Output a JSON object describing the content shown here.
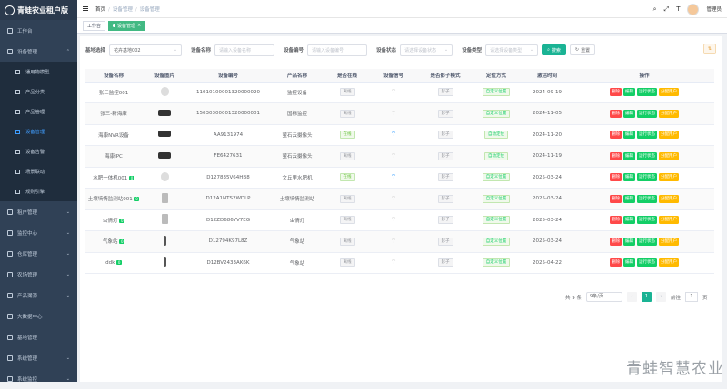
{
  "app": {
    "title": "青蛙农业租户版"
  },
  "sidebar": {
    "items": [
      {
        "label": "工作台"
      },
      {
        "label": "设备管理",
        "expanded": true
      },
      {
        "label": "租户管理"
      },
      {
        "label": "监控中心"
      },
      {
        "label": "仓库管理"
      },
      {
        "label": "农场管理"
      },
      {
        "label": "产品溯源"
      },
      {
        "label": "大数据中心"
      },
      {
        "label": "基地管理"
      },
      {
        "label": "系统管理"
      },
      {
        "label": "系统监控"
      }
    ],
    "sub_items": [
      {
        "label": "通用物模型"
      },
      {
        "label": "产品分类"
      },
      {
        "label": "产品管理"
      },
      {
        "label": "设备管理",
        "active": true
      },
      {
        "label": "设备告警"
      },
      {
        "label": "场景联动"
      },
      {
        "label": "规则引擎"
      }
    ]
  },
  "breadcrumb": [
    "首页",
    "设备管理",
    "设备管理"
  ],
  "user": {
    "name": "管理员"
  },
  "tags": [
    {
      "label": "工作台"
    },
    {
      "label": "设备管理"
    }
  ],
  "filters": {
    "base_label": "基地选择",
    "base_value": "花卉基地002",
    "name_label": "设备名称",
    "name_placeholder": "请输入设备名称",
    "code_label": "设备编号",
    "code_placeholder": "请输入设备编号",
    "status_label": "设备状态",
    "status_placeholder": "请选择设备状态",
    "type_label": "设备类型",
    "type_placeholder": "请选择设备类型",
    "search": "搜索",
    "reset": "重置"
  },
  "table": {
    "headers": [
      "设备名称",
      "设备图片",
      "设备编号",
      "产品名称",
      "是否在线",
      "设备信号",
      "是否影子模式",
      "定位方式",
      "激活时间",
      "操作"
    ],
    "rows": [
      {
        "name": "张三监控001",
        "badge": "",
        "img": "cam",
        "code": "11010100001320000020",
        "product": "监控设备",
        "online": "离线",
        "signal": false,
        "shadow": "影子",
        "loc": "自定义位置",
        "time": "2024-09-19"
      },
      {
        "name": "张三-新海康",
        "badge": "",
        "img": "box",
        "code": "15030300001320000001",
        "product": "国标监控",
        "online": "离线",
        "signal": false,
        "shadow": "影子",
        "loc": "自定义位置",
        "time": "2024-11-05"
      },
      {
        "name": "海康NVR设备",
        "badge": "",
        "img": "box",
        "code": "AA9131974",
        "product": "萤石云摄像头",
        "online": "在线",
        "signal": true,
        "shadow": "影子",
        "loc": "自动定位",
        "time": "2024-11-20"
      },
      {
        "name": "海康IPC",
        "badge": "",
        "img": "box",
        "code": "FE6427631",
        "product": "萤石云摄像头",
        "online": "离线",
        "signal": false,
        "shadow": "影子",
        "loc": "自动定位",
        "time": "2024-11-19"
      },
      {
        "name": "水肥一体机001",
        "badge": "0",
        "img": "cam",
        "code": "D127835V64HB8",
        "product": "文丘里水肥机",
        "online": "在线",
        "signal": true,
        "shadow": "影子",
        "loc": "自定义位置",
        "time": "2025-03-24"
      },
      {
        "name": "土壤墒情监测站001",
        "badge": "0",
        "img": "ins",
        "code": "D12A1NTS2WDLP",
        "product": "土壤墒情监测站",
        "online": "离线",
        "signal": false,
        "shadow": "影子",
        "loc": "自定义位置",
        "time": "2025-03-24"
      },
      {
        "name": "虫情灯",
        "badge": "0",
        "img": "ins",
        "code": "D12ZD686YV7EG",
        "product": "虫情灯",
        "online": "离线",
        "signal": false,
        "shadow": "影子",
        "loc": "自定义位置",
        "time": "2025-03-24"
      },
      {
        "name": "气象站",
        "badge": "0",
        "img": "pole",
        "code": "D12794K97L8Z",
        "product": "气象站",
        "online": "离线",
        "signal": false,
        "shadow": "影子",
        "loc": "自定义位置",
        "time": "2025-03-24"
      },
      {
        "name": "ddk",
        "badge": "0",
        "img": "pole",
        "code": "D12BV2433AK6K",
        "product": "气象站",
        "online": "离线",
        "signal": false,
        "shadow": "影子",
        "loc": "自定义位置",
        "time": "2025-04-22"
      }
    ],
    "ops": [
      "删除",
      "编辑",
      "运行状态",
      "分配用户"
    ]
  },
  "pagination": {
    "total": "共 9 条",
    "size": "9条/页",
    "page": "1",
    "goto": "前往",
    "goto_value": "1",
    "unit": "页"
  },
  "watermark": "青蛙智慧农业"
}
